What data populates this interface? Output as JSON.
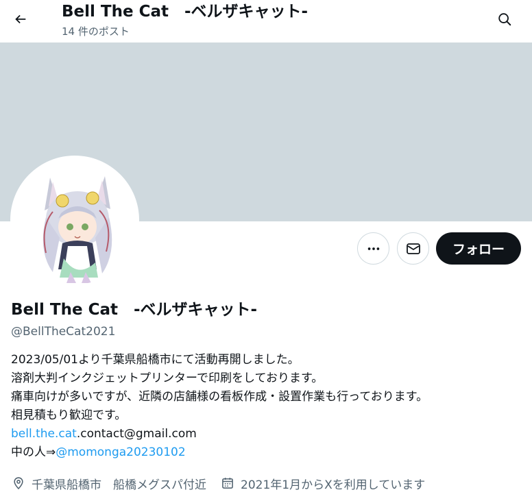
{
  "header": {
    "title": "Bell The Cat　-ベルザキャット-",
    "post_count": "14 件のポスト"
  },
  "profile": {
    "display_name": "Bell The Cat　-ベルザキャット-",
    "handle": "@BellTheCat2021",
    "follow_label": "フォロー",
    "bio": {
      "line1": "2023/05/01より千葉県船橋市にて活動再開しました。",
      "line2": "溶剤大判インクジェットプリンターで印刷をしております。",
      "line3": "痛車向けが多いですが、近隣の店舗様の看板作成・設置作業も行っております。",
      "line4": "相見積もり歓迎です。",
      "email_link": "bell.the.cat",
      "email_rest": ".contact@gmail.com",
      "staff_prefix": "中の人⇒",
      "staff_link": "@momonga20230102"
    },
    "location": "千葉県船橋市　船橋メグスパ付近",
    "joined": "2021年1月からXを利用しています"
  },
  "icons": {
    "back": "arrow-left-icon",
    "search": "search-icon",
    "more": "more-icon",
    "mail": "mail-icon",
    "location": "location-pin-icon",
    "calendar": "calendar-icon"
  },
  "colors": {
    "banner": "#cfd9de",
    "link": "#1d9bf0",
    "text": "#0f1419",
    "secondary": "#536471",
    "follow_bg": "#0f1419"
  }
}
